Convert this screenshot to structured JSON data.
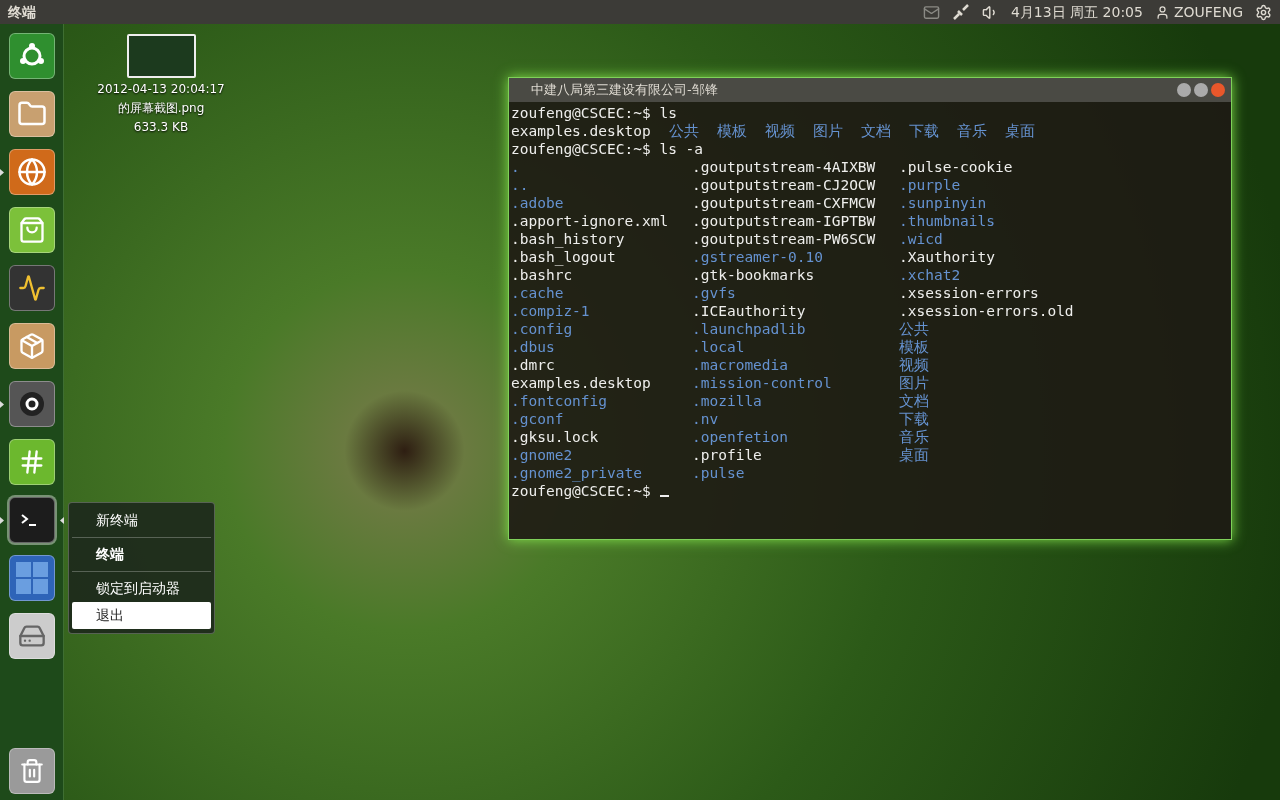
{
  "top_bar": {
    "app_title": "终端",
    "datetime": "4月13日 周五 20:05",
    "user": "ZOUFENG"
  },
  "launcher": {
    "items": [
      {
        "kind": "home",
        "running": false,
        "active": false
      },
      {
        "kind": "folder",
        "running": false,
        "active": false
      },
      {
        "kind": "browser",
        "running": true,
        "active": false
      },
      {
        "kind": "software",
        "running": false,
        "active": false
      },
      {
        "kind": "monitor",
        "running": false,
        "active": false
      },
      {
        "kind": "package",
        "running": false,
        "active": false
      },
      {
        "kind": "letter",
        "running": true,
        "active": false
      },
      {
        "kind": "chat",
        "running": false,
        "active": false
      },
      {
        "kind": "terminal",
        "running": true,
        "active": true
      },
      {
        "kind": "workspaces",
        "running": false,
        "active": false
      },
      {
        "kind": "drive",
        "running": false,
        "active": false
      }
    ],
    "trash": {
      "kind": "trash"
    }
  },
  "context_menu": {
    "items": [
      {
        "label": "新终端",
        "kind": "action",
        "selected": false
      },
      {
        "label": "终端",
        "kind": "title",
        "selected": false
      },
      {
        "label": "锁定到启动器",
        "kind": "action",
        "selected": false
      },
      {
        "label": "退出",
        "kind": "action",
        "selected": true
      }
    ]
  },
  "desktop_file": {
    "name_lines": [
      "2012-04-13 20:04:17",
      "的屏幕截图.png"
    ],
    "size": "633.3 KB"
  },
  "terminal": {
    "title": "中建八局第三建设有限公司-邹锋",
    "lines": [
      {
        "kind": "row",
        "cells": [
          {
            "text": "zoufeng@CSCEC:~$ ls",
            "kind": "file"
          }
        ]
      },
      {
        "kind": "row",
        "cells": [
          {
            "text": "examples.desktop",
            "kind": "file"
          },
          {
            "text": "公共",
            "kind": "dir"
          },
          {
            "text": "模板",
            "kind": "dir"
          },
          {
            "text": "视频",
            "kind": "dir"
          },
          {
            "text": "图片",
            "kind": "dir"
          },
          {
            "text": "文档",
            "kind": "dir"
          },
          {
            "text": "下载",
            "kind": "dir"
          },
          {
            "text": "音乐",
            "kind": "dir"
          },
          {
            "text": "桌面",
            "kind": "dir"
          }
        ]
      },
      {
        "kind": "row",
        "cells": [
          {
            "text": "zoufeng@CSCEC:~$ ls -a",
            "kind": "file"
          }
        ]
      },
      {
        "kind": "columns",
        "cells": [
          {
            "text": ".",
            "kind": "dir"
          },
          {
            "text": ".goutputstream-4AIXBW",
            "kind": "file"
          },
          {
            "text": ".pulse-cookie",
            "kind": "file"
          }
        ]
      },
      {
        "kind": "columns",
        "cells": [
          {
            "text": "..",
            "kind": "dir"
          },
          {
            "text": ".goutputstream-CJ2OCW",
            "kind": "file"
          },
          {
            "text": ".purple",
            "kind": "dir"
          }
        ]
      },
      {
        "kind": "columns",
        "cells": [
          {
            "text": ".adobe",
            "kind": "dir"
          },
          {
            "text": ".goutputstream-CXFMCW",
            "kind": "file"
          },
          {
            "text": ".sunpinyin",
            "kind": "dir"
          }
        ]
      },
      {
        "kind": "columns",
        "cells": [
          {
            "text": ".apport-ignore.xml",
            "kind": "file"
          },
          {
            "text": ".goutputstream-IGPTBW",
            "kind": "file"
          },
          {
            "text": ".thumbnails",
            "kind": "dir"
          }
        ]
      },
      {
        "kind": "columns",
        "cells": [
          {
            "text": ".bash_history",
            "kind": "file"
          },
          {
            "text": ".goutputstream-PW6SCW",
            "kind": "file"
          },
          {
            "text": ".wicd",
            "kind": "dir"
          }
        ]
      },
      {
        "kind": "columns",
        "cells": [
          {
            "text": ".bash_logout",
            "kind": "file"
          },
          {
            "text": ".gstreamer-0.10",
            "kind": "dir"
          },
          {
            "text": ".Xauthority",
            "kind": "file"
          }
        ]
      },
      {
        "kind": "columns",
        "cells": [
          {
            "text": ".bashrc",
            "kind": "file"
          },
          {
            "text": ".gtk-bookmarks",
            "kind": "file"
          },
          {
            "text": ".xchat2",
            "kind": "dir"
          }
        ]
      },
      {
        "kind": "columns",
        "cells": [
          {
            "text": ".cache",
            "kind": "dir"
          },
          {
            "text": ".gvfs",
            "kind": "dir"
          },
          {
            "text": ".xsession-errors",
            "kind": "file"
          }
        ]
      },
      {
        "kind": "columns",
        "cells": [
          {
            "text": ".compiz-1",
            "kind": "dir"
          },
          {
            "text": ".ICEauthority",
            "kind": "file"
          },
          {
            "text": ".xsession-errors.old",
            "kind": "file"
          }
        ]
      },
      {
        "kind": "columns",
        "cells": [
          {
            "text": ".config",
            "kind": "dir"
          },
          {
            "text": ".launchpadlib",
            "kind": "dir"
          },
          {
            "text": "公共",
            "kind": "dir"
          }
        ]
      },
      {
        "kind": "columns",
        "cells": [
          {
            "text": ".dbus",
            "kind": "dir"
          },
          {
            "text": ".local",
            "kind": "dir"
          },
          {
            "text": "模板",
            "kind": "dir"
          }
        ]
      },
      {
        "kind": "columns",
        "cells": [
          {
            "text": ".dmrc",
            "kind": "file"
          },
          {
            "text": ".macromedia",
            "kind": "dir"
          },
          {
            "text": "视频",
            "kind": "dir"
          }
        ]
      },
      {
        "kind": "columns",
        "cells": [
          {
            "text": "examples.desktop",
            "kind": "file"
          },
          {
            "text": ".mission-control",
            "kind": "dir"
          },
          {
            "text": "图片",
            "kind": "dir"
          }
        ]
      },
      {
        "kind": "columns",
        "cells": [
          {
            "text": ".fontconfig",
            "kind": "dir"
          },
          {
            "text": ".mozilla",
            "kind": "dir"
          },
          {
            "text": "文档",
            "kind": "dir"
          }
        ]
      },
      {
        "kind": "columns",
        "cells": [
          {
            "text": ".gconf",
            "kind": "dir"
          },
          {
            "text": ".nv",
            "kind": "dir"
          },
          {
            "text": "下载",
            "kind": "dir"
          }
        ]
      },
      {
        "kind": "columns",
        "cells": [
          {
            "text": ".gksu.lock",
            "kind": "file"
          },
          {
            "text": ".openfetion",
            "kind": "dir"
          },
          {
            "text": "音乐",
            "kind": "dir"
          }
        ]
      },
      {
        "kind": "columns",
        "cells": [
          {
            "text": ".gnome2",
            "kind": "dir"
          },
          {
            "text": ".profile",
            "kind": "file"
          },
          {
            "text": "桌面",
            "kind": "dir"
          }
        ]
      },
      {
        "kind": "columns",
        "cells": [
          {
            "text": ".gnome2_private",
            "kind": "dir"
          },
          {
            "text": ".pulse",
            "kind": "dir"
          }
        ]
      },
      {
        "kind": "prompt",
        "cells": [
          {
            "text": "zoufeng@CSCEC:~$",
            "kind": "file"
          }
        ]
      }
    ]
  }
}
